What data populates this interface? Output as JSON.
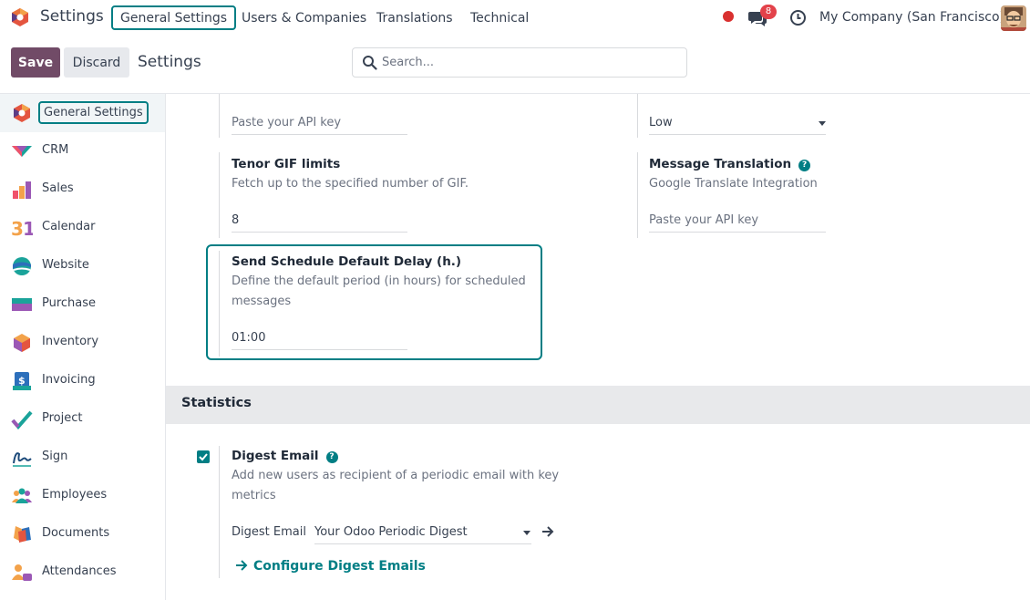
{
  "topbar": {
    "app_name": "Settings",
    "menus": [
      "General Settings",
      "Users & Companies",
      "Translations",
      "Technical"
    ],
    "notification_count": "8",
    "company": "My Company (San Francisco)"
  },
  "control_panel": {
    "save_label": "Save",
    "discard_label": "Discard",
    "breadcrumb": "Settings",
    "search_placeholder": "Search..."
  },
  "sidebar": {
    "items": [
      {
        "label": "General Settings",
        "icon": "settings-icon"
      },
      {
        "label": "CRM",
        "icon": "crm-icon"
      },
      {
        "label": "Sales",
        "icon": "sales-icon"
      },
      {
        "label": "Calendar",
        "icon": "calendar-icon"
      },
      {
        "label": "Website",
        "icon": "website-icon"
      },
      {
        "label": "Purchase",
        "icon": "purchase-icon"
      },
      {
        "label": "Inventory",
        "icon": "inventory-icon"
      },
      {
        "label": "Invoicing",
        "icon": "invoicing-icon"
      },
      {
        "label": "Project",
        "icon": "project-icon"
      },
      {
        "label": "Sign",
        "icon": "sign-icon"
      },
      {
        "label": "Employees",
        "icon": "employees-icon"
      },
      {
        "label": "Documents",
        "icon": "documents-icon"
      },
      {
        "label": "Attendances",
        "icon": "attendances-icon"
      }
    ]
  },
  "settings": {
    "tenor_api_key_placeholder": "Paste your API key",
    "content_filter_value": "Low",
    "tenor_gif_title": "Tenor GIF limits",
    "tenor_gif_desc": "Fetch up to the specified number of GIF.",
    "tenor_gif_value": "8",
    "translation_title": "Message Translation",
    "translation_desc": "Google Translate Integration",
    "translation_key_placeholder": "Paste your API key",
    "delay_title": "Send Schedule Default Delay (h.)",
    "delay_desc_line1": "Define the default period (in hours) for scheduled",
    "delay_desc_line2": "messages",
    "delay_value": "01:00"
  },
  "statistics": {
    "section_title": "Statistics",
    "digest_title": "Digest Email",
    "digest_desc_line1": "Add new users as recipient of a periodic email with key",
    "digest_desc_line2": "metrics",
    "digest_field_label": "Digest Email",
    "digest_field_value": "Your Odoo Periodic Digest",
    "configure_link": "Configure Digest Emails",
    "digest_enabled": true
  },
  "colors": {
    "primary": "#714b67",
    "accent": "#017e84",
    "badge": "#e3424a"
  }
}
